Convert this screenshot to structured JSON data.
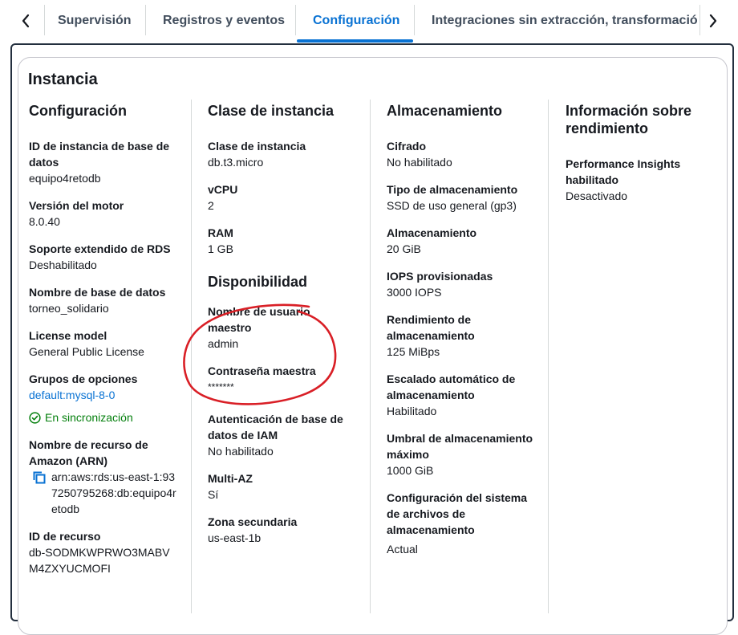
{
  "tabs": [
    {
      "label": "Supervisión"
    },
    {
      "label": "Registros y eventos"
    },
    {
      "label": "Configuración"
    },
    {
      "label": "Integraciones sin extracción, transformación y carga"
    }
  ],
  "panel_title": "Instancia",
  "configuracion": {
    "title": "Configuración",
    "db_instance_id": {
      "label": "ID de instancia de base de datos",
      "value": "equipo4retodb"
    },
    "engine_version": {
      "label": "Versión del motor",
      "value": "8.0.40"
    },
    "extended_support": {
      "label": "Soporte extendido de RDS",
      "value": "Deshabilitado"
    },
    "db_name": {
      "label": "Nombre de base de datos",
      "value": "torneo_solidario"
    },
    "license": {
      "label": "License model",
      "value": "General Public License"
    },
    "option_groups": {
      "label": "Grupos de opciones",
      "value": "default:mysql-8-0",
      "status": "En sincronización"
    },
    "arn": {
      "label": "Nombre de recurso de Amazon (ARN)",
      "value": "arn:aws:rds:us-east-1:937250795268:db:equipo4retodb"
    },
    "resource_id": {
      "label": "ID de recurso",
      "value": "db-SODMKWPRWO3MABVM4ZXYUCMOFI"
    }
  },
  "clase": {
    "title": "Clase de instancia",
    "instance_class": {
      "label": "Clase de instancia",
      "value": "db.t3.micro"
    },
    "vcpu": {
      "label": "vCPU",
      "value": "2"
    },
    "ram": {
      "label": "RAM",
      "value": "1 GB"
    }
  },
  "disponibilidad": {
    "title": "Disponibilidad",
    "master_user": {
      "label": "Nombre de usuario maestro",
      "value": "admin"
    },
    "master_password": {
      "label": "Contraseña maestra",
      "value": "*******"
    },
    "iam_auth": {
      "label": "Autenticación de base de datos de IAM",
      "value": "No habilitado"
    },
    "multi_az": {
      "label": "Multi-AZ",
      "value": "Sí"
    },
    "secondary_zone": {
      "label": "Zona secundaria",
      "value": "us-east-1b"
    }
  },
  "almacenamiento": {
    "title": "Almacenamiento",
    "encryption": {
      "label": "Cifrado",
      "value": "No habilitado"
    },
    "storage_type": {
      "label": "Tipo de almacenamiento",
      "value": "SSD de uso general (gp3)"
    },
    "storage": {
      "label": "Almacenamiento",
      "value": "20 GiB"
    },
    "iops": {
      "label": "IOPS provisionadas",
      "value": "3000 IOPS"
    },
    "throughput": {
      "label": "Rendimiento de almacenamiento",
      "value": "125 MiBps"
    },
    "autoscaling": {
      "label": "Escalado automático de almacenamiento",
      "value": "Habilitado"
    },
    "max_threshold": {
      "label": "Umbral de almacenamiento máximo",
      "value": "1000 GiB"
    },
    "fs_config": {
      "label": "Configuración del sistema de archivos de almacenamiento",
      "value": "Actual"
    }
  },
  "rendimiento": {
    "title": "Información sobre rendimiento",
    "pi": {
      "label": "Performance Insights habilitado",
      "value": "Desactivado"
    }
  },
  "colors": {
    "accent": "#0972d3",
    "success": "#037f0c",
    "annotation": "#d91f26"
  },
  "icons": [
    "chevron-left-icon",
    "chevron-right-icon",
    "check-circle-icon",
    "copy-icon"
  ]
}
